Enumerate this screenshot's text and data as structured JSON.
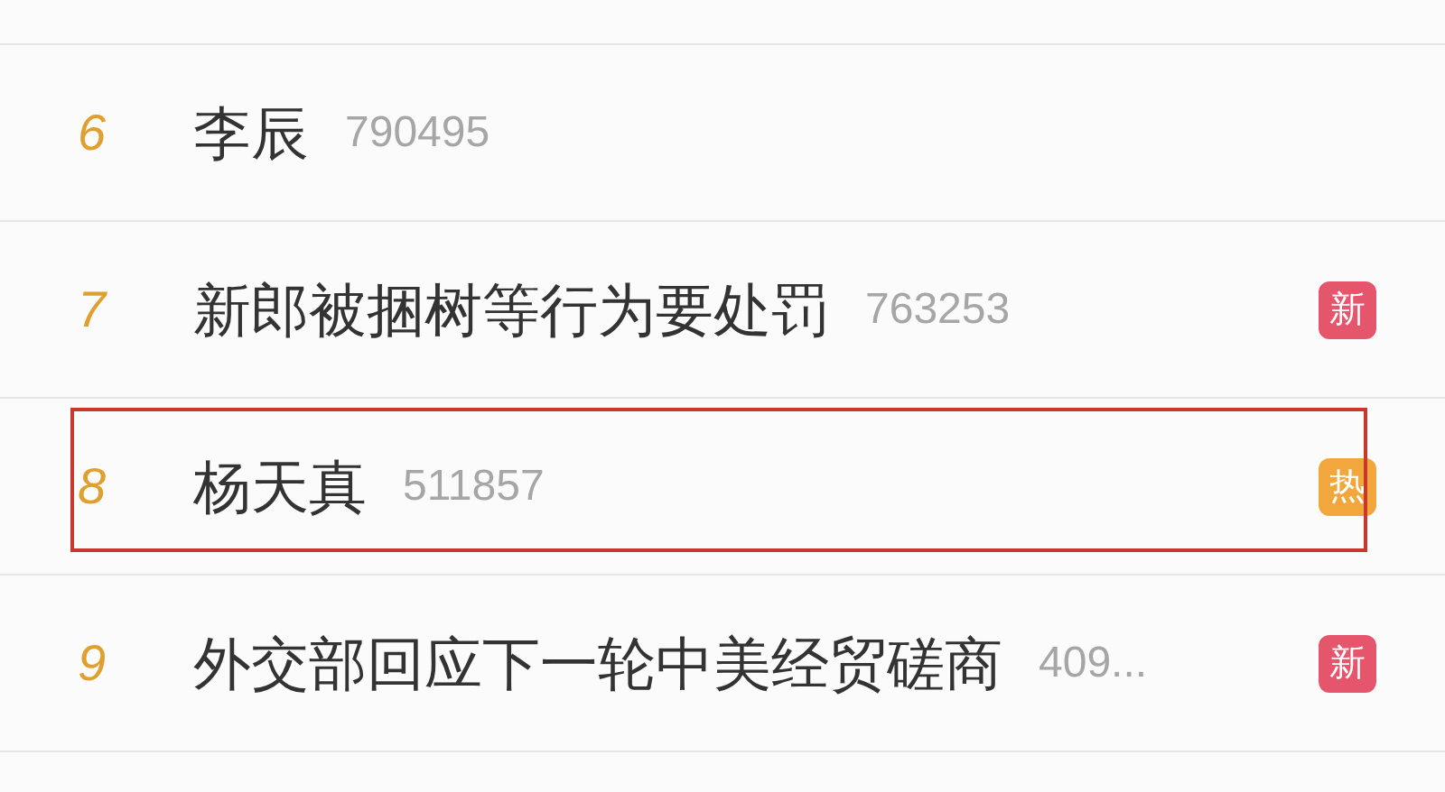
{
  "hot_list": [
    {
      "rank": "6",
      "title": "李辰",
      "count": "790495",
      "highlighted": false
    },
    {
      "rank": "7",
      "title": "新郎被捆树等行为要处罚",
      "count": "763253",
      "highlighted": false,
      "badge": {
        "text": "新",
        "color": "#e5566c"
      }
    },
    {
      "rank": "8",
      "title": "杨天真",
      "count": "511857",
      "highlighted": true,
      "badge": {
        "text": "热",
        "color": "#f2a73c"
      }
    },
    {
      "rank": "9",
      "title": "外交部回应下一轮中美经贸磋商",
      "count": "409...",
      "highlighted": false,
      "badge": {
        "text": "新",
        "color": "#e5566c"
      }
    }
  ]
}
